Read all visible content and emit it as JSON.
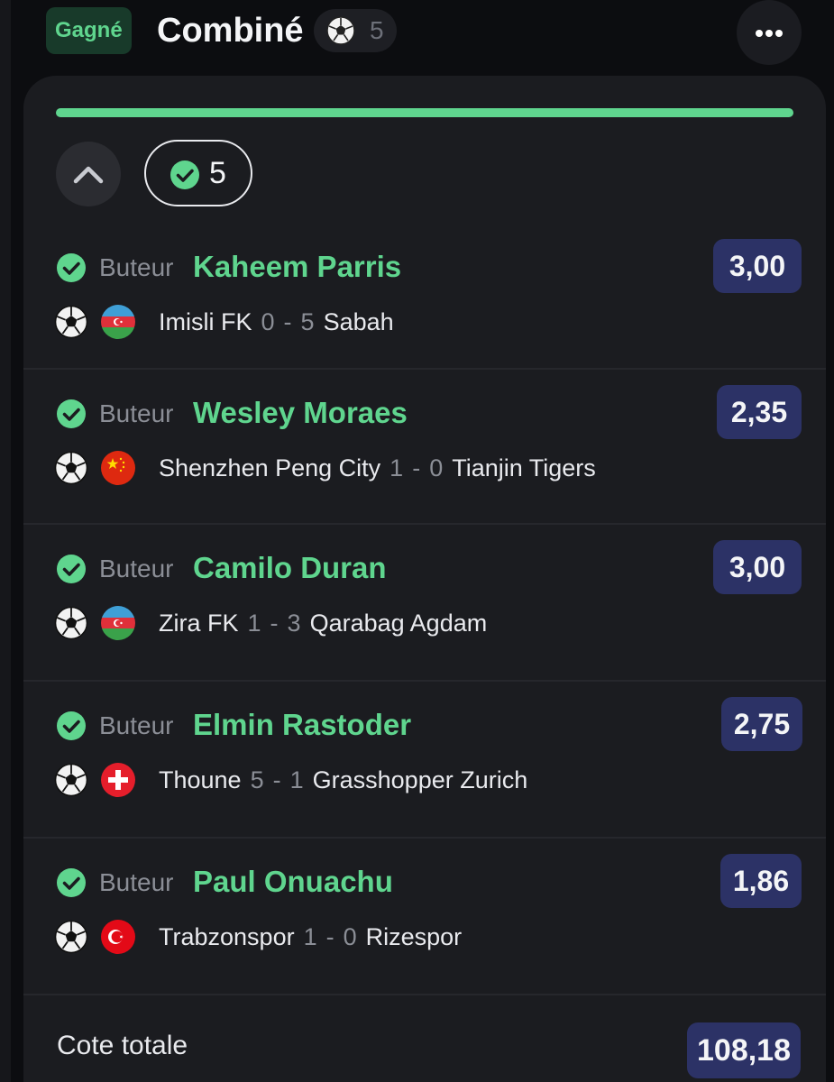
{
  "header": {
    "status": "Gagné",
    "title": "Combiné",
    "sport_icon": "soccer-ball-icon",
    "selection_count": "5",
    "more_icon": "more-horizontal-icon"
  },
  "progress": {
    "fraction": 1.0,
    "color": "#5fd58e"
  },
  "summary": {
    "won_count": "5",
    "collapse_icon": "chevron-up-icon",
    "check_icon": "check-circle-icon"
  },
  "selections": [
    {
      "market": "Buteur",
      "player": "Kaheem Parris",
      "odds": "3,00",
      "flag": "azerbaijan-flag-icon",
      "home": "Imisli FK",
      "home_score": "0",
      "sep": "-",
      "away_score": "5",
      "away": "Sabah"
    },
    {
      "market": "Buteur",
      "player": "Wesley Moraes",
      "odds": "2,35",
      "flag": "china-flag-icon",
      "home": "Shenzhen Peng City",
      "home_score": "1",
      "sep": "-",
      "away_score": "0",
      "away": "Tianjin Tigers"
    },
    {
      "market": "Buteur",
      "player": "Camilo Duran",
      "odds": "3,00",
      "flag": "azerbaijan-flag-icon",
      "home": "Zira FK",
      "home_score": "1",
      "sep": "-",
      "away_score": "3",
      "away": "Qarabag Agdam"
    },
    {
      "market": "Buteur",
      "player": "Elmin Rastoder",
      "odds": "2,75",
      "flag": "switzerland-flag-icon",
      "home": "Thoune",
      "home_score": "5",
      "sep": "-",
      "away_score": "1",
      "away": "Grasshopper Zurich"
    },
    {
      "market": "Buteur",
      "player": "Paul Onuachu",
      "odds": "1,86",
      "flag": "turkey-flag-icon",
      "home": "Trabzonspor",
      "home_score": "1",
      "sep": "-",
      "away_score": "0",
      "away": "Rizespor"
    }
  ],
  "total": {
    "label": "Cote totale",
    "odds": "108,18"
  },
  "colors": {
    "won_green": "#5fd58e",
    "odds_bg": "#2c3266",
    "card_bg": "#1b1c20",
    "page_bg": "#0c0d10"
  }
}
